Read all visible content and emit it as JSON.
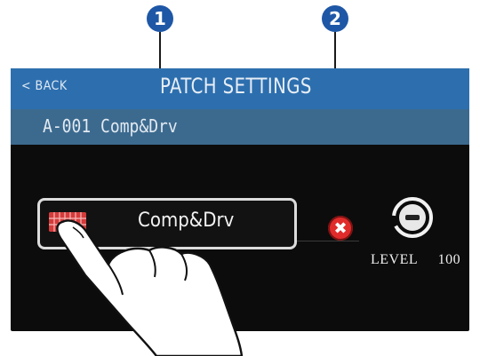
{
  "callouts": {
    "one": "1",
    "two": "2"
  },
  "header": {
    "back_label": "< BACK",
    "title": "PATCH SETTINGS"
  },
  "patch": {
    "name_line": "A-001 Comp&Drv"
  },
  "effect": {
    "name": "Comp&Drv",
    "icon": "effect-chain-icon",
    "delete_icon": "delete-icon"
  },
  "level": {
    "label": "LEVEL",
    "value": "100"
  },
  "colors": {
    "header_bg": "#2d6fae",
    "subbar_bg": "#3c6a8f",
    "screen_bg": "#0c0c0c",
    "accent_red": "#e02b2b",
    "callout_blue": "#1e57a6"
  }
}
